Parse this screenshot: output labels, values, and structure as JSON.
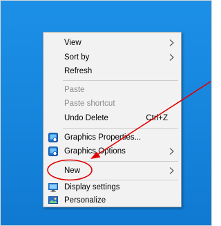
{
  "context_menu": {
    "items": [
      {
        "label": "View",
        "submenu": true
      },
      {
        "label": "Sort by",
        "submenu": true
      },
      {
        "label": "Refresh"
      },
      {
        "label": "Paste",
        "disabled": true
      },
      {
        "label": "Paste shortcut",
        "disabled": true
      },
      {
        "label": "Undo Delete",
        "shortcut": "Ctrl+Z"
      },
      {
        "label": "Graphics Properties...",
        "icon": "intel-graphics-icon"
      },
      {
        "label": "Graphics Options",
        "icon": "intel-graphics-icon",
        "submenu": true
      },
      {
        "label": "New",
        "submenu": true
      },
      {
        "label": "Display settings",
        "icon": "display-icon"
      },
      {
        "label": "Personalize",
        "icon": "personalize-icon"
      }
    ]
  },
  "annotation": {
    "color": "#e00000",
    "highlighted_item": "New"
  },
  "desktop": {
    "background_color": "#1787de"
  }
}
